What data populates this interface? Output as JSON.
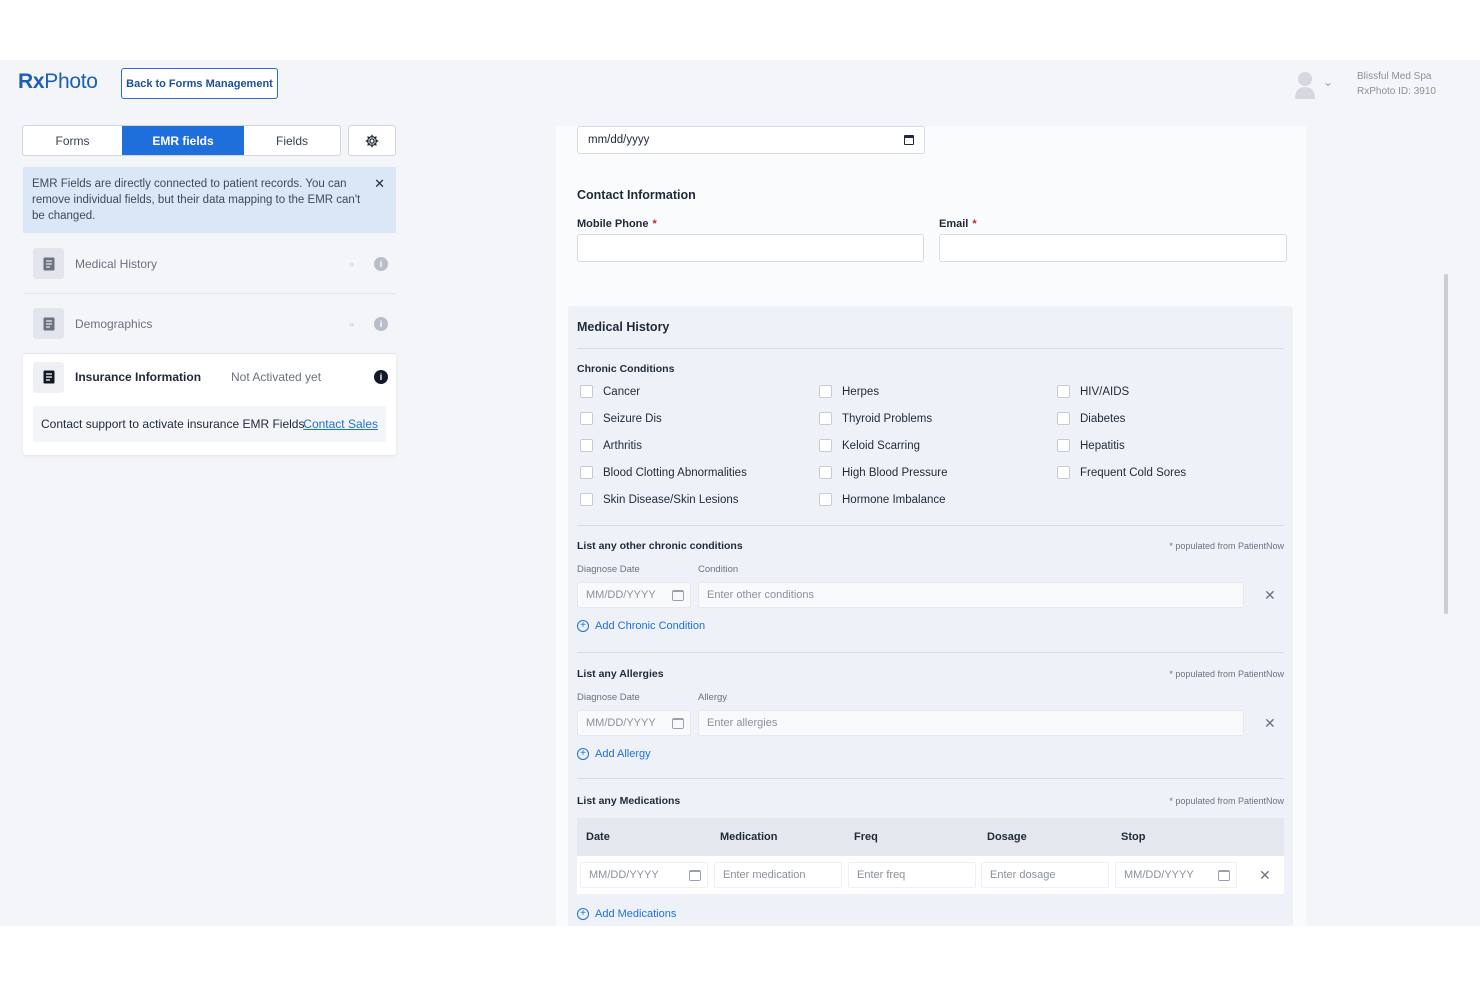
{
  "header": {
    "logo_rx": "Rx",
    "logo_text": "Photo",
    "back_button": "Back to Forms Management",
    "org_name": "Blissful Med Spa",
    "org_id": "RxPhoto ID: 3910"
  },
  "sidebar": {
    "tabs": [
      {
        "label": "Forms",
        "active": false
      },
      {
        "label": "EMR fields",
        "active": true
      },
      {
        "label": "Fields",
        "active": false
      }
    ],
    "notice": "EMR Fields are directly connected to patient records. You can remove individual fields, but their data mapping to the EMR can't be changed.",
    "items": [
      {
        "label": "Medical History"
      },
      {
        "label": "Demographics"
      }
    ],
    "insurance": {
      "label": "Insurance Information",
      "status": "Not Activated yet",
      "message": "Contact support to activate insurance EMR Fields",
      "link": "Contact Sales"
    }
  },
  "form": {
    "date_placeholder": "mm/dd/yyyy",
    "contact_title": "Contact Information",
    "mobile_label": "Mobile Phone",
    "email_label": "Email",
    "required_mark": "*",
    "medical_history_title": "Medical History",
    "chronic_title": "Chronic Conditions",
    "conditions": [
      [
        "Cancer",
        "Herpes",
        "HIV/AIDS"
      ],
      [
        "Seizure Dis",
        "Thyroid Problems",
        "Diabetes"
      ],
      [
        "Arthritis",
        "Keloid Scarring",
        "Hepatitis"
      ],
      [
        "Blood Clotting Abnormalities",
        "High Blood Pressure",
        "Frequent Cold Sores"
      ],
      [
        "Skin Disease/Skin Lesions",
        "Hormone Imbalance",
        ""
      ]
    ],
    "populated_note": "* populated from PatientNow",
    "other_chronic": {
      "title": "List any other chronic conditions",
      "date_label": "Diagnose Date",
      "field_label": "Condition",
      "date_placeholder": "MM/DD/YYYY",
      "field_placeholder": "Enter other conditions",
      "add_label": "Add Chronic Condition"
    },
    "allergies": {
      "title": "List any Allergies",
      "date_label": "Diagnose Date",
      "field_label": "Allergy",
      "date_placeholder": "MM/DD/YYYY",
      "field_placeholder": "Enter allergies",
      "add_label": "Add Allergy"
    },
    "medications": {
      "title": "List any Medications",
      "columns": [
        "Date",
        "Medication",
        "Freq",
        "Dosage",
        "Stop"
      ],
      "row_placeholders": [
        "MM/DD/YYYY",
        "Enter medication",
        "Enter freq",
        "Enter dosage",
        "MM/DD/YYYY"
      ],
      "add_label": "Add Medications"
    }
  }
}
